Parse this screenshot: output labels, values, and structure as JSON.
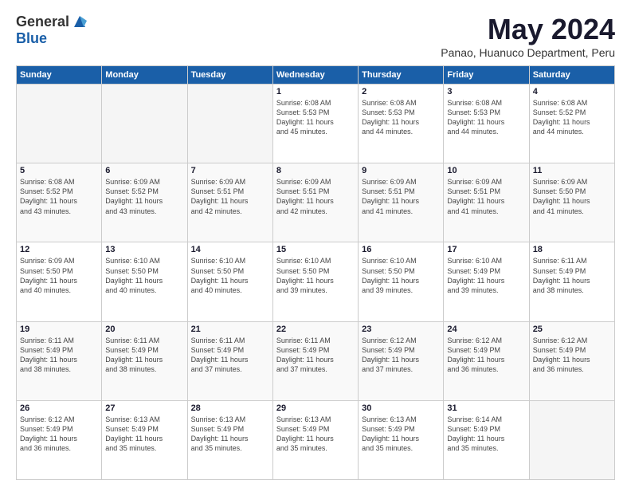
{
  "logo": {
    "general": "General",
    "blue": "Blue"
  },
  "title": "May 2024",
  "subtitle": "Panao, Huanuco Department, Peru",
  "days_header": [
    "Sunday",
    "Monday",
    "Tuesday",
    "Wednesday",
    "Thursday",
    "Friday",
    "Saturday"
  ],
  "weeks": [
    [
      {
        "num": "",
        "info": ""
      },
      {
        "num": "",
        "info": ""
      },
      {
        "num": "",
        "info": ""
      },
      {
        "num": "1",
        "info": "Sunrise: 6:08 AM\nSunset: 5:53 PM\nDaylight: 11 hours\nand 45 minutes."
      },
      {
        "num": "2",
        "info": "Sunrise: 6:08 AM\nSunset: 5:53 PM\nDaylight: 11 hours\nand 44 minutes."
      },
      {
        "num": "3",
        "info": "Sunrise: 6:08 AM\nSunset: 5:53 PM\nDaylight: 11 hours\nand 44 minutes."
      },
      {
        "num": "4",
        "info": "Sunrise: 6:08 AM\nSunset: 5:52 PM\nDaylight: 11 hours\nand 44 minutes."
      }
    ],
    [
      {
        "num": "5",
        "info": "Sunrise: 6:08 AM\nSunset: 5:52 PM\nDaylight: 11 hours\nand 43 minutes."
      },
      {
        "num": "6",
        "info": "Sunrise: 6:09 AM\nSunset: 5:52 PM\nDaylight: 11 hours\nand 43 minutes."
      },
      {
        "num": "7",
        "info": "Sunrise: 6:09 AM\nSunset: 5:51 PM\nDaylight: 11 hours\nand 42 minutes."
      },
      {
        "num": "8",
        "info": "Sunrise: 6:09 AM\nSunset: 5:51 PM\nDaylight: 11 hours\nand 42 minutes."
      },
      {
        "num": "9",
        "info": "Sunrise: 6:09 AM\nSunset: 5:51 PM\nDaylight: 11 hours\nand 41 minutes."
      },
      {
        "num": "10",
        "info": "Sunrise: 6:09 AM\nSunset: 5:51 PM\nDaylight: 11 hours\nand 41 minutes."
      },
      {
        "num": "11",
        "info": "Sunrise: 6:09 AM\nSunset: 5:50 PM\nDaylight: 11 hours\nand 41 minutes."
      }
    ],
    [
      {
        "num": "12",
        "info": "Sunrise: 6:09 AM\nSunset: 5:50 PM\nDaylight: 11 hours\nand 40 minutes."
      },
      {
        "num": "13",
        "info": "Sunrise: 6:10 AM\nSunset: 5:50 PM\nDaylight: 11 hours\nand 40 minutes."
      },
      {
        "num": "14",
        "info": "Sunrise: 6:10 AM\nSunset: 5:50 PM\nDaylight: 11 hours\nand 40 minutes."
      },
      {
        "num": "15",
        "info": "Sunrise: 6:10 AM\nSunset: 5:50 PM\nDaylight: 11 hours\nand 39 minutes."
      },
      {
        "num": "16",
        "info": "Sunrise: 6:10 AM\nSunset: 5:50 PM\nDaylight: 11 hours\nand 39 minutes."
      },
      {
        "num": "17",
        "info": "Sunrise: 6:10 AM\nSunset: 5:49 PM\nDaylight: 11 hours\nand 39 minutes."
      },
      {
        "num": "18",
        "info": "Sunrise: 6:11 AM\nSunset: 5:49 PM\nDaylight: 11 hours\nand 38 minutes."
      }
    ],
    [
      {
        "num": "19",
        "info": "Sunrise: 6:11 AM\nSunset: 5:49 PM\nDaylight: 11 hours\nand 38 minutes."
      },
      {
        "num": "20",
        "info": "Sunrise: 6:11 AM\nSunset: 5:49 PM\nDaylight: 11 hours\nand 38 minutes."
      },
      {
        "num": "21",
        "info": "Sunrise: 6:11 AM\nSunset: 5:49 PM\nDaylight: 11 hours\nand 37 minutes."
      },
      {
        "num": "22",
        "info": "Sunrise: 6:11 AM\nSunset: 5:49 PM\nDaylight: 11 hours\nand 37 minutes."
      },
      {
        "num": "23",
        "info": "Sunrise: 6:12 AM\nSunset: 5:49 PM\nDaylight: 11 hours\nand 37 minutes."
      },
      {
        "num": "24",
        "info": "Sunrise: 6:12 AM\nSunset: 5:49 PM\nDaylight: 11 hours\nand 36 minutes."
      },
      {
        "num": "25",
        "info": "Sunrise: 6:12 AM\nSunset: 5:49 PM\nDaylight: 11 hours\nand 36 minutes."
      }
    ],
    [
      {
        "num": "26",
        "info": "Sunrise: 6:12 AM\nSunset: 5:49 PM\nDaylight: 11 hours\nand 36 minutes."
      },
      {
        "num": "27",
        "info": "Sunrise: 6:13 AM\nSunset: 5:49 PM\nDaylight: 11 hours\nand 35 minutes."
      },
      {
        "num": "28",
        "info": "Sunrise: 6:13 AM\nSunset: 5:49 PM\nDaylight: 11 hours\nand 35 minutes."
      },
      {
        "num": "29",
        "info": "Sunrise: 6:13 AM\nSunset: 5:49 PM\nDaylight: 11 hours\nand 35 minutes."
      },
      {
        "num": "30",
        "info": "Sunrise: 6:13 AM\nSunset: 5:49 PM\nDaylight: 11 hours\nand 35 minutes."
      },
      {
        "num": "31",
        "info": "Sunrise: 6:14 AM\nSunset: 5:49 PM\nDaylight: 11 hours\nand 35 minutes."
      },
      {
        "num": "",
        "info": ""
      }
    ]
  ]
}
